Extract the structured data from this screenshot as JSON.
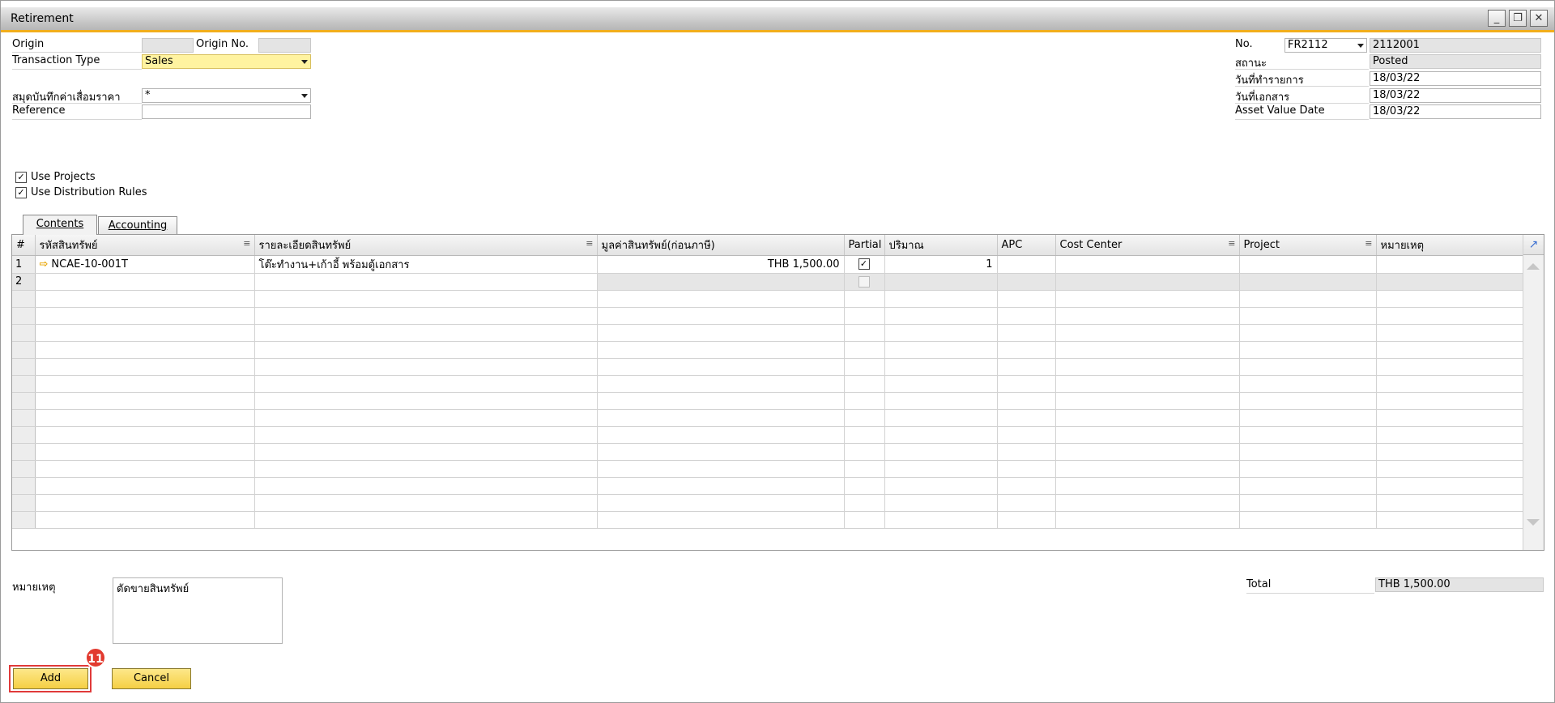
{
  "window": {
    "title": "Retirement",
    "minimize": "_",
    "restore": "❐",
    "close": "✕"
  },
  "header_left": {
    "origin_label": "Origin",
    "origin_value": "",
    "origin_no_label": "Origin No.",
    "origin_no_value": "",
    "transaction_type_label": "Transaction Type",
    "transaction_type_value": "Sales",
    "depreciation_book_label": "สมุดบันทึกค่าเสื่อมราคา",
    "depreciation_book_value": "*",
    "reference_label": "Reference",
    "reference_value": ""
  },
  "header_right": {
    "no_label": "No.",
    "series_value": "FR2112",
    "number_value": "2112001",
    "status_label": "สถานะ",
    "status_value": "Posted",
    "posting_date_label": "วันที่ทำรายการ",
    "posting_date_value": "18/03/22",
    "document_date_label": "วันที่เอกสาร",
    "document_date_value": "18/03/22",
    "asset_value_date_label": "Asset Value Date",
    "asset_value_date_value": "18/03/22"
  },
  "options": {
    "use_projects": "Use Projects",
    "use_distribution_rules": "Use Distribution Rules"
  },
  "tabs": [
    {
      "label": "Contents"
    },
    {
      "label": "Accounting"
    }
  ],
  "grid": {
    "columns": [
      "#",
      "รหัสสินทรัพย์",
      "รายละเอียดสินทรัพย์",
      "มูลค่าสินทรัพย์(ก่อนภาษี)",
      "Partial",
      "ปริมาณ",
      "APC",
      "Cost Center",
      "Project",
      "หมายเหตุ"
    ],
    "rows": [
      {
        "no": "1",
        "asset_code": "NCAE-10-001T",
        "description": "โต๊ะทำงาน+เก้าอี้ พร้อมตู้เอกสาร",
        "value": "THB 1,500.00",
        "partial": true,
        "quantity": "1",
        "apc": "",
        "cost_center": "",
        "project": "",
        "remarks": ""
      },
      {
        "no": "2",
        "asset_code": "",
        "description": "",
        "value": "",
        "partial": false,
        "quantity": "",
        "apc": "",
        "cost_center": "",
        "project": "",
        "remarks": ""
      }
    ]
  },
  "footer": {
    "remarks_label": "หมายเหตุ",
    "remarks_value": "ตัดขายสินทรัพย์",
    "total_label": "Total",
    "total_value": "THB 1,500.00"
  },
  "buttons": {
    "add": "Add",
    "cancel": "Cancel"
  },
  "step_badge": "11",
  "colors": {
    "accent": "#f2ae1c",
    "button": "#f5cf44",
    "highlight_field": "#fff3a0",
    "badge": "#e23a2f"
  }
}
